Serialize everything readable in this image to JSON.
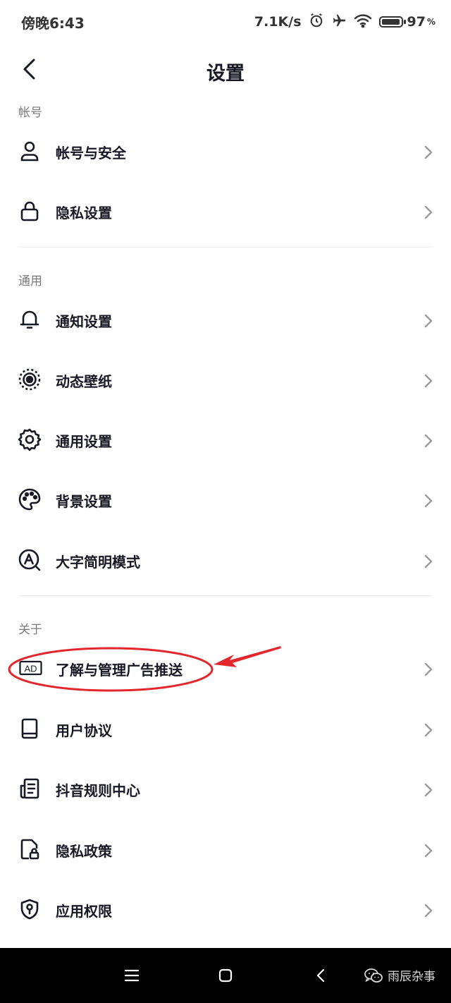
{
  "status_bar": {
    "time": "傍晚6:43",
    "net_speed": "7.1K/s",
    "battery_percent": "97",
    "percent_sign": "%",
    "battery_level": 0.97,
    "icons": [
      "alarm-icon",
      "airplane-icon",
      "wifi-icon",
      "battery-icon"
    ]
  },
  "header": {
    "title": "设置",
    "back_icon": "chevron-left-icon"
  },
  "sections": [
    {
      "label": "帐号",
      "items": [
        {
          "label": "帐号与安全",
          "icon": "user-icon"
        },
        {
          "label": "隐私设置",
          "icon": "lock-icon"
        }
      ]
    },
    {
      "label": "通用",
      "items": [
        {
          "label": "通知设置",
          "icon": "bell-icon"
        },
        {
          "label": "动态壁纸",
          "icon": "live-wallpaper-icon"
        },
        {
          "label": "通用设置",
          "icon": "gear-icon"
        },
        {
          "label": "背景设置",
          "icon": "palette-icon"
        },
        {
          "label": "大字简明模式",
          "icon": "large-font-icon"
        }
      ]
    },
    {
      "label": "关于",
      "items": [
        {
          "label": "了解与管理广告推送",
          "icon": "ad-icon",
          "ad_text": "AD"
        },
        {
          "label": "用户协议",
          "icon": "book-icon"
        },
        {
          "label": "抖音规则中心",
          "icon": "document-list-icon"
        },
        {
          "label": "隐私政策",
          "icon": "privacy-document-icon"
        },
        {
          "label": "应用权限",
          "icon": "shield-icon"
        }
      ]
    }
  ],
  "annotation": {
    "color": "#e3262b"
  },
  "nav_bar": {
    "watermark": "雨辰杂事",
    "icons": [
      "menu-icon",
      "home-square-icon",
      "back-triangle-icon",
      "wechat-icon"
    ]
  }
}
